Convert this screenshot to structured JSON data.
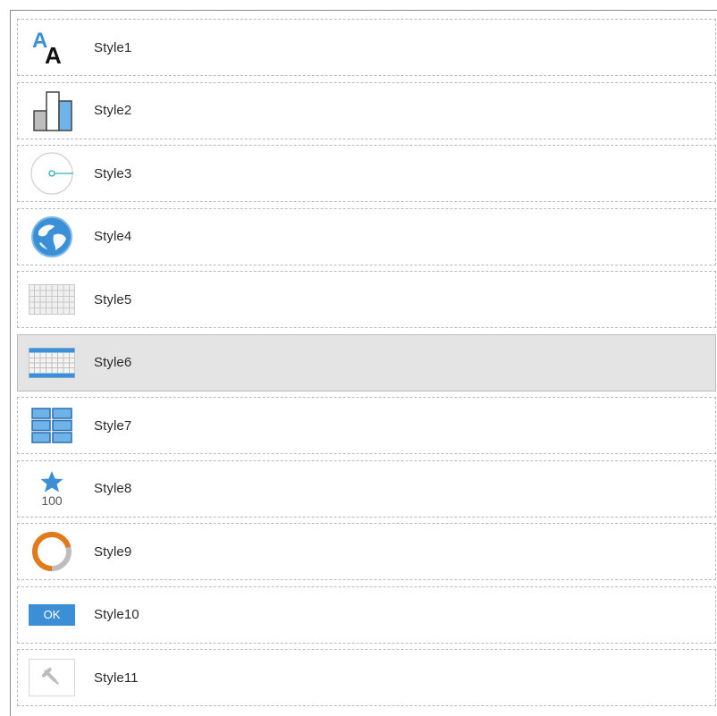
{
  "style_list": {
    "items": [
      {
        "label": "Style1",
        "icon": "font-size-icon"
      },
      {
        "label": "Style2",
        "icon": "bar-chart-icon"
      },
      {
        "label": "Style3",
        "icon": "radius-dial-icon"
      },
      {
        "label": "Style4",
        "icon": "globe-icon"
      },
      {
        "label": "Style5",
        "icon": "gray-grid-icon"
      },
      {
        "label": "Style6",
        "icon": "blue-header-grid-icon",
        "selected": true
      },
      {
        "label": "Style7",
        "icon": "tiles-icon"
      },
      {
        "label": "Style8",
        "icon": "star-rating-icon",
        "icon_text": "100"
      },
      {
        "label": "Style9",
        "icon": "progress-ring-icon"
      },
      {
        "label": "Style10",
        "icon": "ok-button-icon",
        "icon_text": "OK"
      },
      {
        "label": "Style11",
        "icon": "hammer-icon"
      }
    ]
  },
  "colors": {
    "accent_blue": "#3a8fd6",
    "light_blue": "#6fb3e8",
    "orange": "#e07a1a",
    "teal": "#2bb3b8",
    "selected_bg": "#e4e4e4"
  }
}
